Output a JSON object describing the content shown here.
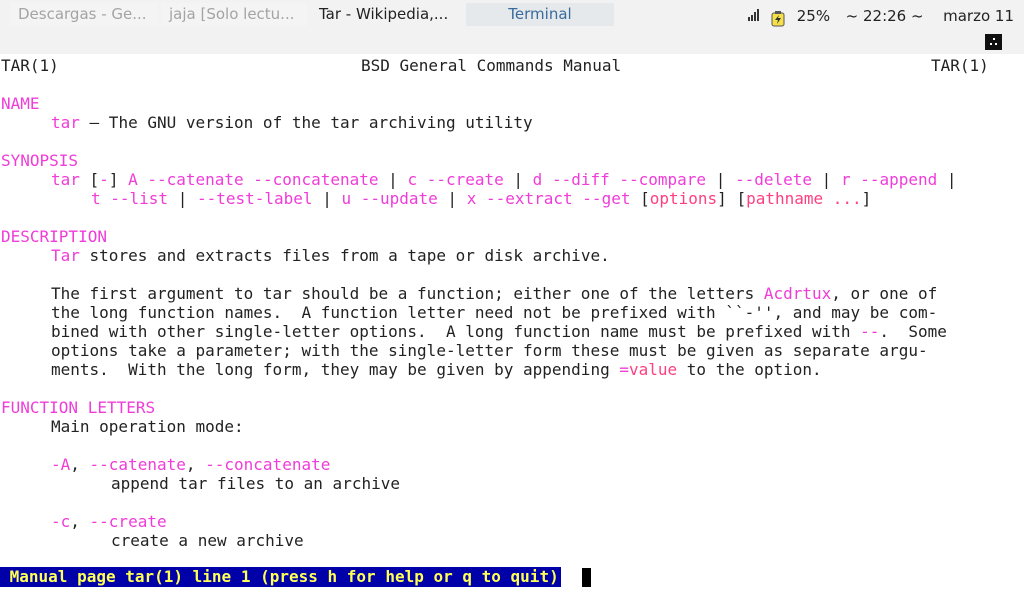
{
  "panel": {
    "tabs": [
      {
        "label": "Descargas - Ge..."
      },
      {
        "label": "jaja [Solo lectu..."
      },
      {
        "label": "Tar - Wikipedia,..."
      },
      {
        "label": "Terminal"
      }
    ],
    "battery": "25%",
    "clock": "~ 22:26 ~",
    "date": "marzo 11"
  },
  "man": {
    "header_left": "TAR(1)",
    "header_center": "BSD General Commands Manual",
    "header_right": "TAR(1)",
    "name_heading": "NAME",
    "name_cmd": "tar",
    "name_desc": " — The GNU version of the tar archiving utility",
    "synopsis_heading": "SYNOPSIS",
    "syn1": {
      "cmd": "tar",
      "a": " [",
      "b": "-",
      "c": "] ",
      "d": "A --catenate --concatenate",
      "e": " | ",
      "f": "c --create",
      "g": " | ",
      "h": "d --diff --compare",
      "i": " | ",
      "j": "--delete",
      "k": " | ",
      "l": "r --append",
      "m": " |"
    },
    "syn2": {
      "a": "t --list",
      "b": " | ",
      "c": "--test-label",
      "d": " | ",
      "e": "u --update",
      "f": " | ",
      "g": "x --extract --get",
      "h": " [",
      "i": "options",
      "j": "] [",
      "k": "pathname ...",
      "l": "]"
    },
    "description_heading": "DESCRIPTION",
    "desc1_kw": "Tar",
    "desc1_rest": " stores and extracts files from a tape or disk archive.",
    "p1a": "The first argument to tar should be a function; either one of the letters ",
    "p1a_kw": "Acdrtux",
    "p1a_end": ", or one of",
    "p1b": "the long function names.  A function letter need not be prefixed with ``-'', and may be com-",
    "p1c": "bined with other single-letter options.  A long function name must be prefixed with ",
    "p1c_kw": "--",
    "p1c_end": ".  Some",
    "p1d": "options take a parameter; with the single-letter form these must be given as separate argu-",
    "p1e": "ments.  With the long form, they may be given by appending ",
    "p1e_kw1": "=",
    "p1e_kw2": "value",
    "p1e_end": " to the option.",
    "fl_heading": "FUNCTION LETTERS",
    "fl_intro": "Main operation mode:",
    "optA_flag": "-A",
    "optA_sep1": ", ",
    "optA_l1": "--catenate",
    "optA_sep2": ", ",
    "optA_l2": "--concatenate",
    "optA_desc": "append tar files to an archive",
    "optC_flag": "-c",
    "optC_sep": ", ",
    "optC_l": "--create",
    "optC_desc": "create a new archive"
  },
  "status": {
    "text": " Manual page tar(1) line 1 (press h for help or q to quit)"
  },
  "colors": {
    "section": "#f03cd8",
    "option_arg": "#ff3f7f",
    "status_bg": "#0000a8",
    "status_fg": "#ffff54"
  }
}
